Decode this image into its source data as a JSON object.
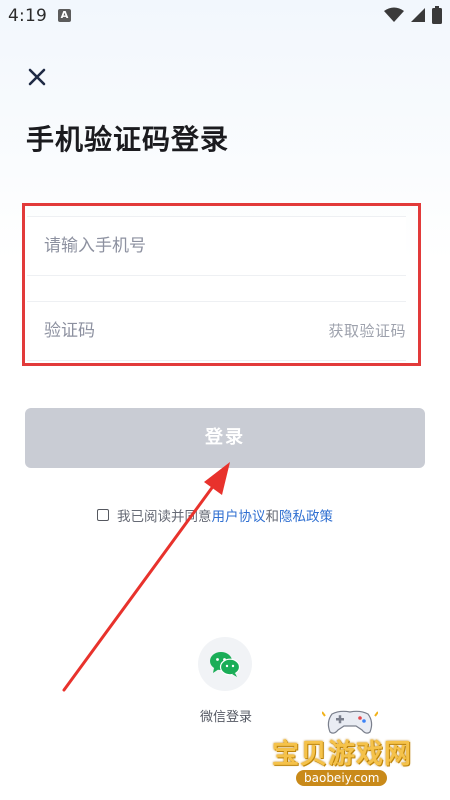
{
  "status_bar": {
    "time": "4:19",
    "notification_badge": "A"
  },
  "page": {
    "title": "手机验证码登录"
  },
  "form": {
    "phone_placeholder": "请输入手机号",
    "code_placeholder": "验证码",
    "get_code_label": "获取验证码",
    "login_label": "登录"
  },
  "agreement": {
    "prefix": "我已阅读并同意",
    "user_agreement": "用户协议",
    "and": "和",
    "privacy_policy": "隐私政策"
  },
  "wechat": {
    "label": "微信登录"
  },
  "watermark": {
    "name": "宝贝游戏网",
    "domain": "baobeiy.com"
  },
  "colors": {
    "highlight": "#e23a3a",
    "login_button_disabled": "#c9ccd4",
    "link": "#2f6fd1",
    "wechat_green": "#1aad57"
  },
  "icons": {
    "close": "close-icon",
    "wifi": "wifi-icon",
    "signal": "signal-icon",
    "battery": "battery-icon",
    "wechat": "wechat-icon"
  }
}
